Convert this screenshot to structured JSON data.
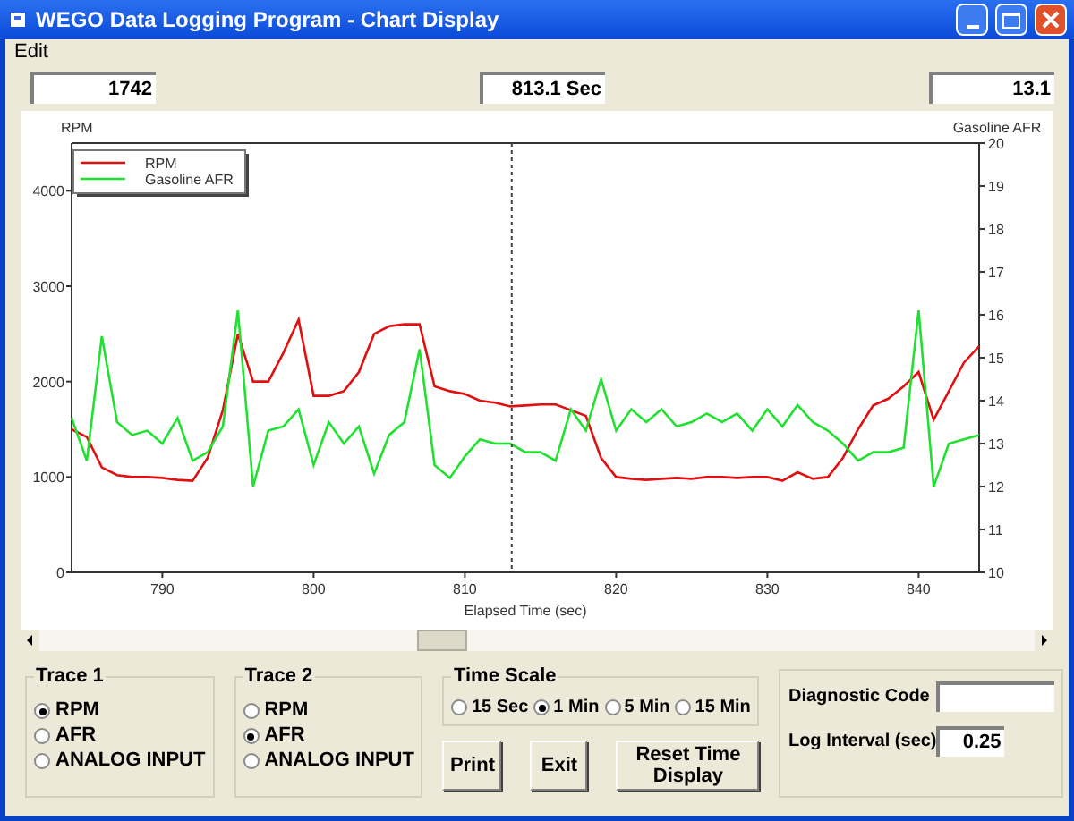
{
  "window": {
    "title": "WEGO Data Logging Program - Chart Display"
  },
  "menu": [
    "Edit"
  ],
  "readouts": {
    "trace_1": "1742",
    "time": "813.1 Sec",
    "trace_2": "13.1"
  },
  "chart": {
    "chart_data": {
      "type": "line",
      "xlabel": "Elapsed Time (sec)",
      "ylabel": "RPM",
      "y2label": "Gasoline AFR",
      "xlim": [
        784,
        844
      ],
      "ylim": [
        0,
        4500
      ],
      "y2lim": [
        10,
        20
      ],
      "xticks": [
        790,
        800,
        810,
        820,
        830,
        840
      ],
      "yticks": [
        0,
        1000,
        2000,
        3000,
        4000
      ],
      "y2ticks": [
        10,
        11,
        12,
        13,
        14,
        15,
        16,
        17,
        18,
        19,
        20
      ],
      "x": [
        784,
        785,
        786,
        787,
        788,
        789,
        790,
        791,
        792,
        793,
        794,
        795,
        796,
        797,
        798,
        799,
        800,
        801,
        802,
        803,
        804,
        805,
        806,
        807,
        808,
        809,
        810,
        811,
        812,
        813,
        814,
        815,
        816,
        817,
        818,
        819,
        820,
        821,
        822,
        823,
        824,
        825,
        826,
        827,
        828,
        829,
        830,
        831,
        832,
        833,
        834,
        835,
        836,
        837,
        838,
        839,
        840,
        841,
        842,
        843,
        844
      ],
      "series": [
        {
          "name": "RPM",
          "color": "#e01010",
          "values": [
            1500,
            1420,
            1100,
            1020,
            1000,
            1000,
            990,
            970,
            960,
            1200,
            1700,
            2500,
            2000,
            2000,
            2300,
            2650,
            1850,
            1850,
            1900,
            2100,
            2500,
            2580,
            2600,
            2600,
            1950,
            1900,
            1870,
            1800,
            1780,
            1740,
            1750,
            1760,
            1760,
            1700,
            1640,
            1200,
            1000,
            980,
            970,
            980,
            990,
            980,
            1000,
            1000,
            990,
            1000,
            1000,
            960,
            1050,
            980,
            1000,
            1200,
            1500,
            1750,
            1820,
            1950,
            2100,
            1600,
            1900,
            2200,
            2370
          ]
        },
        {
          "name": "Gasoline AFR",
          "color": "#20e030",
          "axis": "y2",
          "values": [
            13.6,
            12.6,
            15.5,
            13.5,
            13.2,
            13.3,
            13.0,
            13.6,
            12.6,
            12.8,
            13.4,
            16.1,
            12.0,
            13.3,
            13.4,
            13.8,
            12.5,
            13.5,
            13.0,
            13.4,
            12.3,
            13.2,
            13.5,
            15.2,
            12.5,
            12.2,
            12.7,
            13.1,
            13.0,
            13.0,
            12.8,
            12.8,
            12.6,
            13.8,
            13.3,
            14.5,
            13.3,
            13.8,
            13.5,
            13.8,
            13.4,
            13.5,
            13.7,
            13.5,
            13.7,
            13.3,
            13.8,
            13.4,
            13.9,
            13.5,
            13.3,
            13.0,
            12.6,
            12.8,
            12.8,
            12.9,
            16.1,
            12.0,
            13.0,
            13.1,
            13.2
          ]
        }
      ],
      "ref_lines": [
        {
          "axis": "x",
          "value": 813.1
        }
      ],
      "legend": "upper left"
    }
  },
  "trace_1": {
    "title": "Trace 1",
    "options": [
      {
        "label": "RPM",
        "selected": true
      },
      {
        "label": "AFR",
        "selected": false
      },
      {
        "label": "ANALOG INPUT",
        "selected": false
      }
    ]
  },
  "trace_2": {
    "title": "Trace 2",
    "options": [
      {
        "label": "RPM",
        "selected": false
      },
      {
        "label": "AFR",
        "selected": true
      },
      {
        "label": "ANALOG INPUT",
        "selected": false
      }
    ]
  },
  "time_scale": {
    "title": "Time Scale",
    "options": [
      {
        "label": "15 Sec",
        "selected": false
      },
      {
        "label": "1 Min",
        "selected": true
      },
      {
        "label": "5 Min",
        "selected": false
      },
      {
        "label": "15 Min",
        "selected": false
      }
    ]
  },
  "buttons": [
    "Print",
    "Exit",
    "Reset Time Display"
  ],
  "diagnostic_code": {
    "label": "Diagnostic Code"
  },
  "log_interval": {
    "label": "Log Interval (sec)",
    "value": "0.25"
  }
}
